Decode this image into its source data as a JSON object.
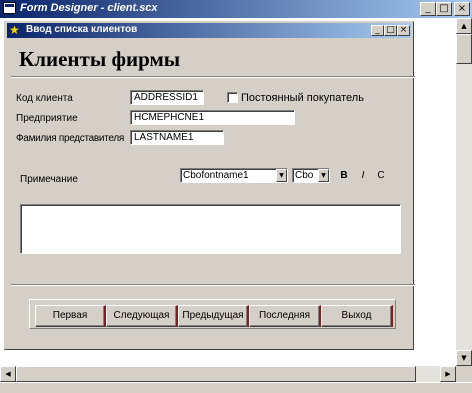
{
  "outer_window": {
    "title": "Form Designer - client.scx",
    "controls": {
      "minimize": "_",
      "maximize": "□",
      "close": "×"
    }
  },
  "form": {
    "title": "Ввод списка клиентов",
    "controls": {
      "minimize": "_",
      "maximize": "□",
      "close": "×"
    },
    "heading": "Клиенты фирмы",
    "fields": {
      "client_code": {
        "label": "Код клиента",
        "value": "ADDRESSID1"
      },
      "regular_customer": {
        "label": "Постоянный покупатель"
      },
      "company": {
        "label": "Предприятие",
        "value": "HCMEPHCNE1"
      },
      "representative": {
        "label": "Фамилия представителя",
        "value": "LASTNAME1"
      },
      "notes": {
        "label": "Примечание",
        "value": ""
      }
    },
    "format_toolbar": {
      "font_name": "Cbofontname1",
      "font_size": "Cbo",
      "bold": "B",
      "italic": "I",
      "underline": "C"
    },
    "nav_buttons": [
      "Первая",
      "Следующая",
      "Предыдущая",
      "Последняя",
      "Выход"
    ]
  },
  "icons": {
    "outer_window": "window-icon",
    "form_window": "wizard-star-icon"
  }
}
